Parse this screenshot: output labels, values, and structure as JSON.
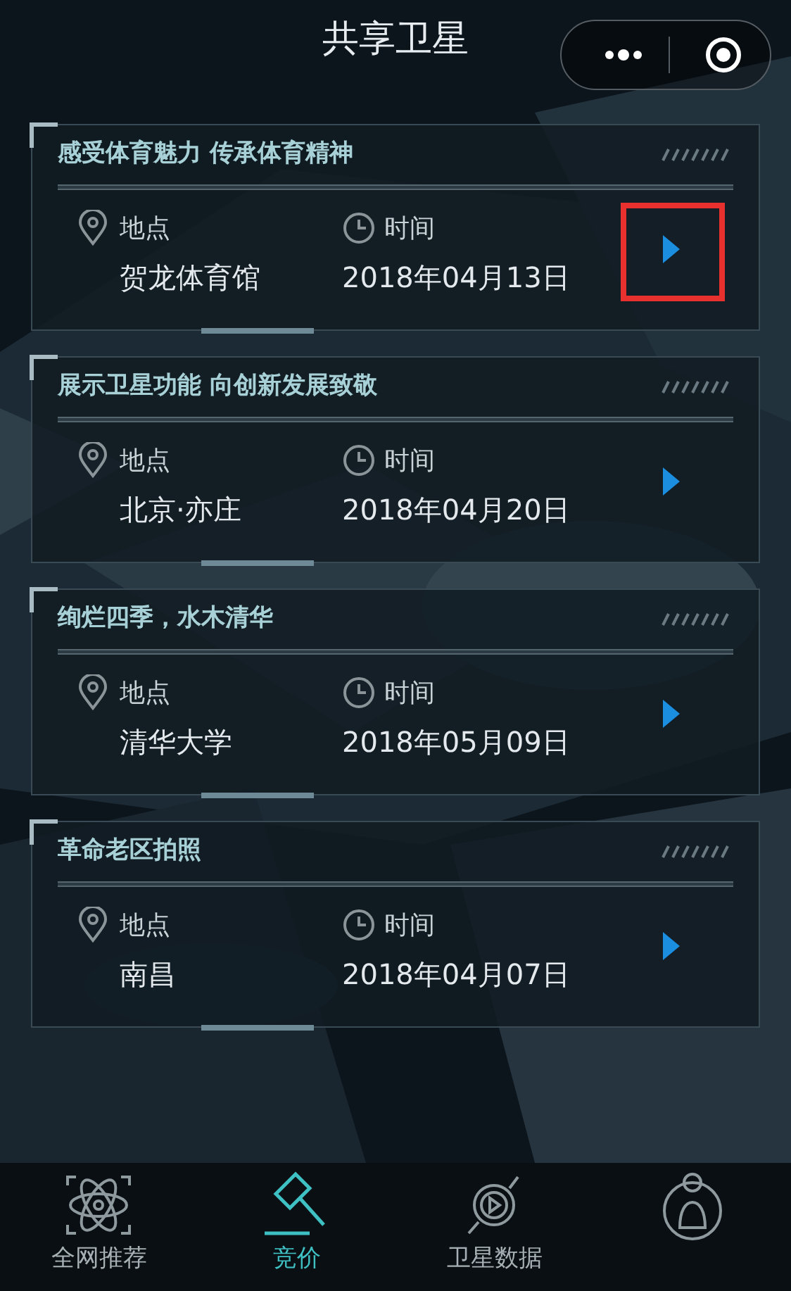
{
  "header": {
    "title": "共享卫星"
  },
  "events": [
    {
      "title": "感受体育魅力 传承体育精神",
      "place_label": "地点",
      "place": "贺龙体育馆",
      "time_label": "时间",
      "date": "2018年04月13日",
      "highlighted": true
    },
    {
      "title": "展示卫星功能 向创新发展致敬",
      "place_label": "地点",
      "place": "北京·亦庄",
      "time_label": "时间",
      "date": "2018年04月20日",
      "highlighted": false
    },
    {
      "title": "绚烂四季，水木清华",
      "place_label": "地点",
      "place": "清华大学",
      "time_label": "时间",
      "date": "2018年05月09日",
      "highlighted": false
    },
    {
      "title": "革命老区拍照",
      "place_label": "地点",
      "place": "南昌",
      "time_label": "时间",
      "date": "2018年04月07日",
      "highlighted": false
    }
  ],
  "tabs": [
    {
      "kind": "atom",
      "label": "全网推荐",
      "selected": false
    },
    {
      "kind": "gavel",
      "label": "竞价",
      "selected": true
    },
    {
      "kind": "satellite",
      "label": "卫星数据",
      "selected": false
    },
    {
      "kind": "user",
      "selected": false
    }
  ]
}
